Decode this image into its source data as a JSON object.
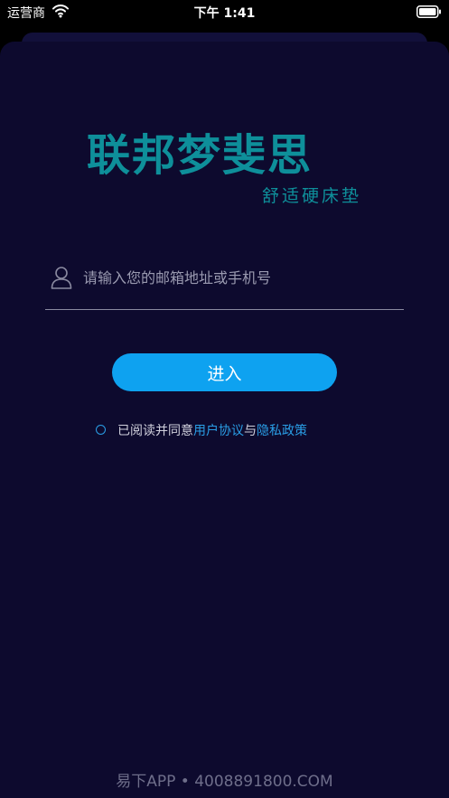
{
  "status_bar": {
    "carrier": "运营商",
    "time": "下午 1:41"
  },
  "logo": {
    "title": "联邦梦斐思",
    "subtitle": "舒适硬床垫"
  },
  "login": {
    "account_placeholder": "请输入您的邮箱地址或手机号",
    "account_value": "",
    "enter_label": "进入"
  },
  "agreement": {
    "prefix": "已阅读并同意",
    "user_agreement": "用户协议",
    "and": "与",
    "privacy_policy": "隐私政策",
    "checked": false
  },
  "watermark": "易下APP • 4008891800.COM",
  "colors": {
    "background": "#0d0a2e",
    "brand_teal": "#0e8f9a",
    "accent_blue": "#0ea2f0",
    "link_blue": "#2a9ee6"
  }
}
